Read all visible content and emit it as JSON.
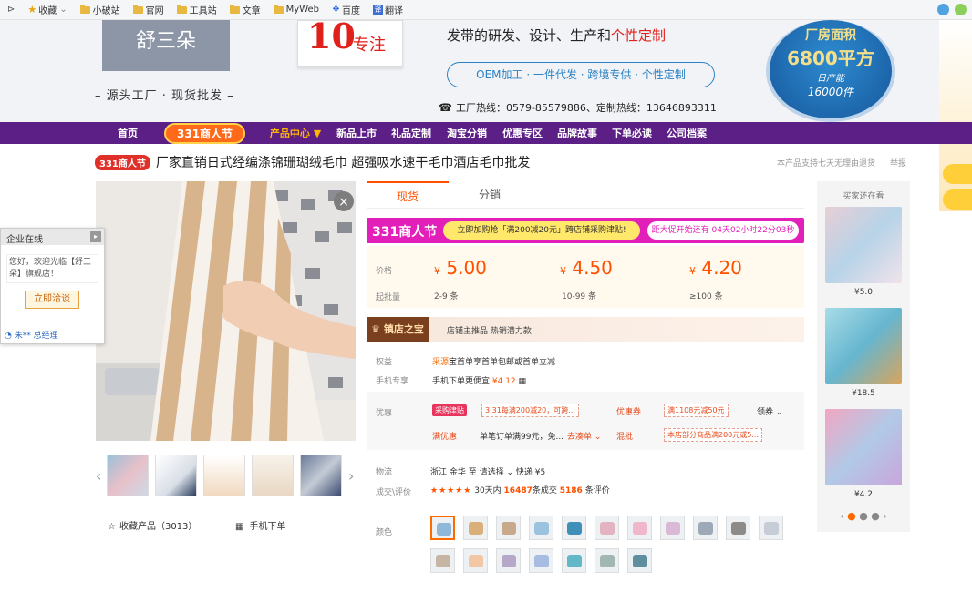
{
  "bookmarks": {
    "items": [
      {
        "label": "收藏",
        "icon": "star-icon"
      },
      {
        "label": "小破站",
        "icon": "folder-icon"
      },
      {
        "label": "官网",
        "icon": "folder-icon"
      },
      {
        "label": "工具站",
        "icon": "folder-icon"
      },
      {
        "label": "文章",
        "icon": "folder-icon"
      },
      {
        "label": "MyWeb",
        "icon": "folder-icon"
      },
      {
        "label": "百度",
        "icon": "baidu-icon"
      },
      {
        "label": "翻译",
        "icon": "translate-icon"
      }
    ]
  },
  "banner": {
    "logo_text": "舒三朵",
    "tagline": "– 源头工厂 · 现货批发 –",
    "badge_number": "10",
    "badge_text": "专注",
    "slogan_pre": "发带的研发、设计、生产和",
    "slogan_highlight": "个性定制",
    "oem": "OEM加工 · 一件代发 · 跨境专供 · 个性定制",
    "hotline": "工厂热线：0579-85579886、定制热线：13646893311",
    "circle_line1": "厂房面积",
    "circle_line2": "6800平方",
    "circle_line3": "日产能",
    "circle_line4": "16000件"
  },
  "nav": {
    "items": [
      "首页",
      "331商人节",
      "产品中心 ▼",
      "新品上市",
      "礼品定制",
      "淘宝分销",
      "优惠专区",
      "品牌故事",
      "下单必读",
      "公司档案"
    ]
  },
  "product": {
    "tag": "331商人节",
    "title": "厂家直销日式经编涤锦珊瑚绒毛巾 超强吸水速干毛巾酒店毛巾批发",
    "note": "本产品支持七天无理由退货",
    "report": "举报"
  },
  "gallery": {
    "favorite": "收藏产品（3013）",
    "mobile_order": "手机下单"
  },
  "chat": {
    "header": "企业在线",
    "message": "您好，欢迎光临【舒三朵】旗舰店！",
    "button": "立即洽谈",
    "manager": "朱** 总经理"
  },
  "tabs": [
    "现货",
    "分销"
  ],
  "promo": {
    "label": "331商人节",
    "middle": "立即加购抢「满200减20元」跨店铺采购津贴!",
    "right": "距大促开始还有 04天02小时22分03秒"
  },
  "pricing": {
    "price_label": "价格",
    "moq_label": "起批量",
    "currency": "¥",
    "tiers": [
      {
        "price": "5.00",
        "qty": "2-9 条"
      },
      {
        "price": "4.50",
        "qty": "10-99 条"
      },
      {
        "price": "4.20",
        "qty": "≥100 条"
      }
    ]
  },
  "shop": {
    "badge": "镇店之宝",
    "text": "店铺主推品   热销潜力款"
  },
  "rights": {
    "label": "权益",
    "tag": "采源",
    "text": "宝首单享首单包邮或首单立减"
  },
  "mobile": {
    "label": "手机专享",
    "text": "手机下单更便宜",
    "price": "¥4.12"
  },
  "discounts": {
    "label": "优惠",
    "tag": "采购津贴",
    "coupon1": "3.31每满200减20，可跨...",
    "coupon_label1": "优惠券",
    "coupon2": "满1108元减50元",
    "more1": "领券",
    "label2": "满优惠",
    "text2": "单笔订单满99元，免...",
    "more2": "去凑单",
    "label3": "混批",
    "coupon3": "本店部分商品满200元或5..."
  },
  "logistics": {
    "label": "物流",
    "from": "浙江 金华",
    "to_word": "至",
    "to": "请选择",
    "express": "快递 ¥5"
  },
  "reviews": {
    "label": "成交\\评价",
    "stars": "★★★★★",
    "sold_pre": "30天内",
    "sold_num": "16487",
    "sold_post": "条成交",
    "review_num": "5186",
    "review_post": "条评价"
  },
  "colors": {
    "label": "颜色",
    "swatches": [
      "#8fb8d8",
      "#d9b07a",
      "#c9a98c",
      "#9bc3e0",
      "#3f8fb8",
      "#e3b3c2",
      "#f0b6c9",
      "#d9b9d5",
      "#9da9b6",
      "#8e8a87",
      "#c7cdd6",
      "#c6b5a3",
      "#f1c7a5",
      "#b6a8c9",
      "#a7bce0",
      "#63b8c8",
      "#a0b7b2",
      "#5f8f9e"
    ]
  },
  "recommend": {
    "title": "买家还在看",
    "items": [
      {
        "price": "¥5.0"
      },
      {
        "price": "¥18.5"
      },
      {
        "price": "¥4.2"
      }
    ]
  }
}
